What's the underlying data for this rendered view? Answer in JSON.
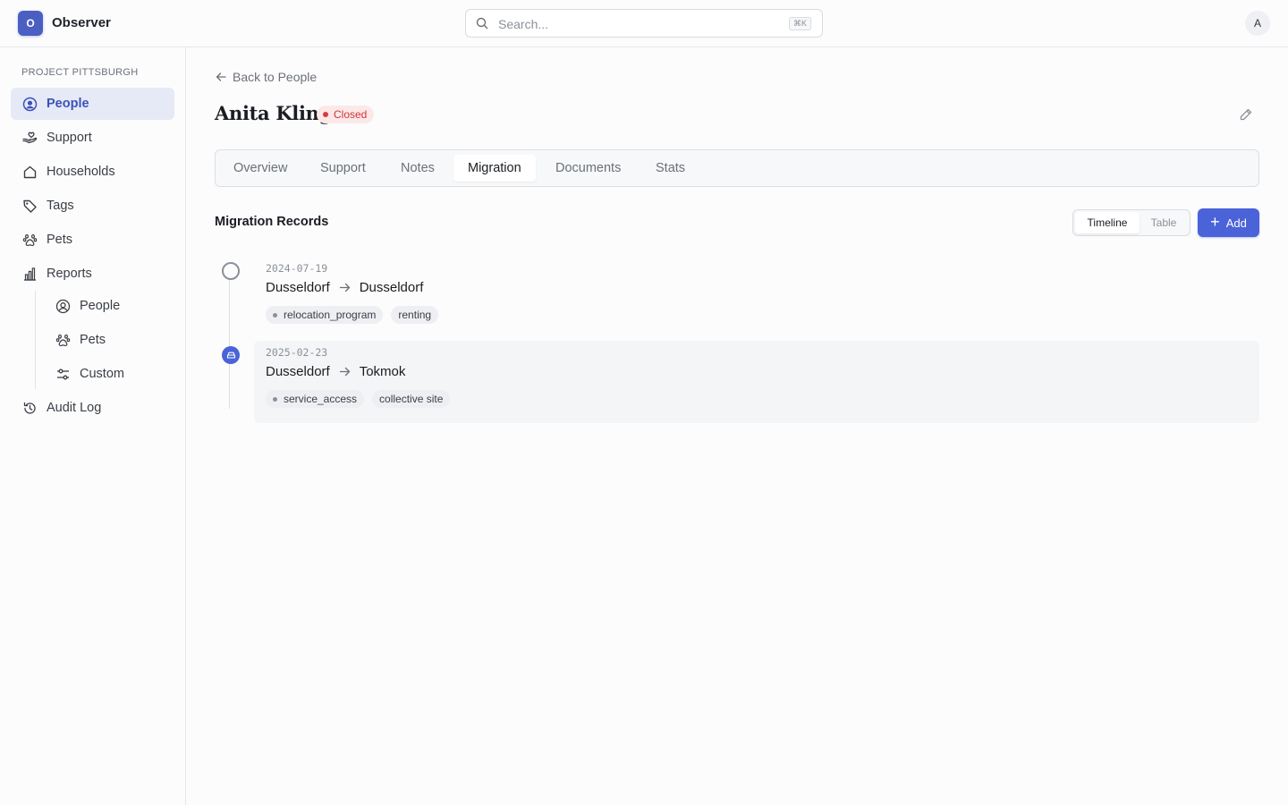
{
  "header": {
    "logo_letter": "O",
    "app_name": "Observer",
    "search_placeholder": "Search...",
    "search_shortcut": "⌘K",
    "avatar_initial": "A"
  },
  "sidebar": {
    "section_label": "PROJECT PITTSBURGH",
    "items": [
      {
        "label": "People",
        "icon": "user-circle-icon",
        "active": true
      },
      {
        "label": "Support",
        "icon": "hand-heart-icon"
      },
      {
        "label": "Households",
        "icon": "house-icon"
      },
      {
        "label": "Tags",
        "icon": "tag-icon"
      },
      {
        "label": "Pets",
        "icon": "paw-icon"
      },
      {
        "label": "Reports",
        "icon": "bar-chart-icon"
      }
    ],
    "report_items": [
      {
        "label": "People",
        "icon": "user-circle-icon"
      },
      {
        "label": "Pets",
        "icon": "paw-icon"
      },
      {
        "label": "Custom",
        "icon": "sliders-icon"
      }
    ],
    "audit_log": {
      "label": "Audit Log",
      "icon": "history-icon"
    }
  },
  "main": {
    "back_label": "Back to People",
    "person_name": "Anita Kling",
    "status": "Closed",
    "status_color": "#c9373b",
    "tabs": [
      "Overview",
      "Support",
      "Notes",
      "Migration",
      "Documents",
      "Stats"
    ],
    "active_tab": "Migration",
    "section_title": "Migration Records",
    "view_options": [
      "Timeline",
      "Table"
    ],
    "active_view": "Timeline",
    "add_label": "Add",
    "accent_color": "#4a63d8"
  },
  "records": [
    {
      "date": "2024-07-19",
      "from": "Dusseldorf",
      "to": "Dusseldorf",
      "tags": [
        {
          "label": "relocation_program",
          "dot": true
        },
        {
          "label": "renting",
          "dot": false
        }
      ],
      "marker": "open-circle"
    },
    {
      "date": "2025-02-23",
      "from": "Dusseldorf",
      "to": "Tokmok",
      "tags": [
        {
          "label": "service_access",
          "dot": true
        },
        {
          "label": "collective site",
          "dot": false
        }
      ],
      "marker": "filled-icon"
    }
  ]
}
